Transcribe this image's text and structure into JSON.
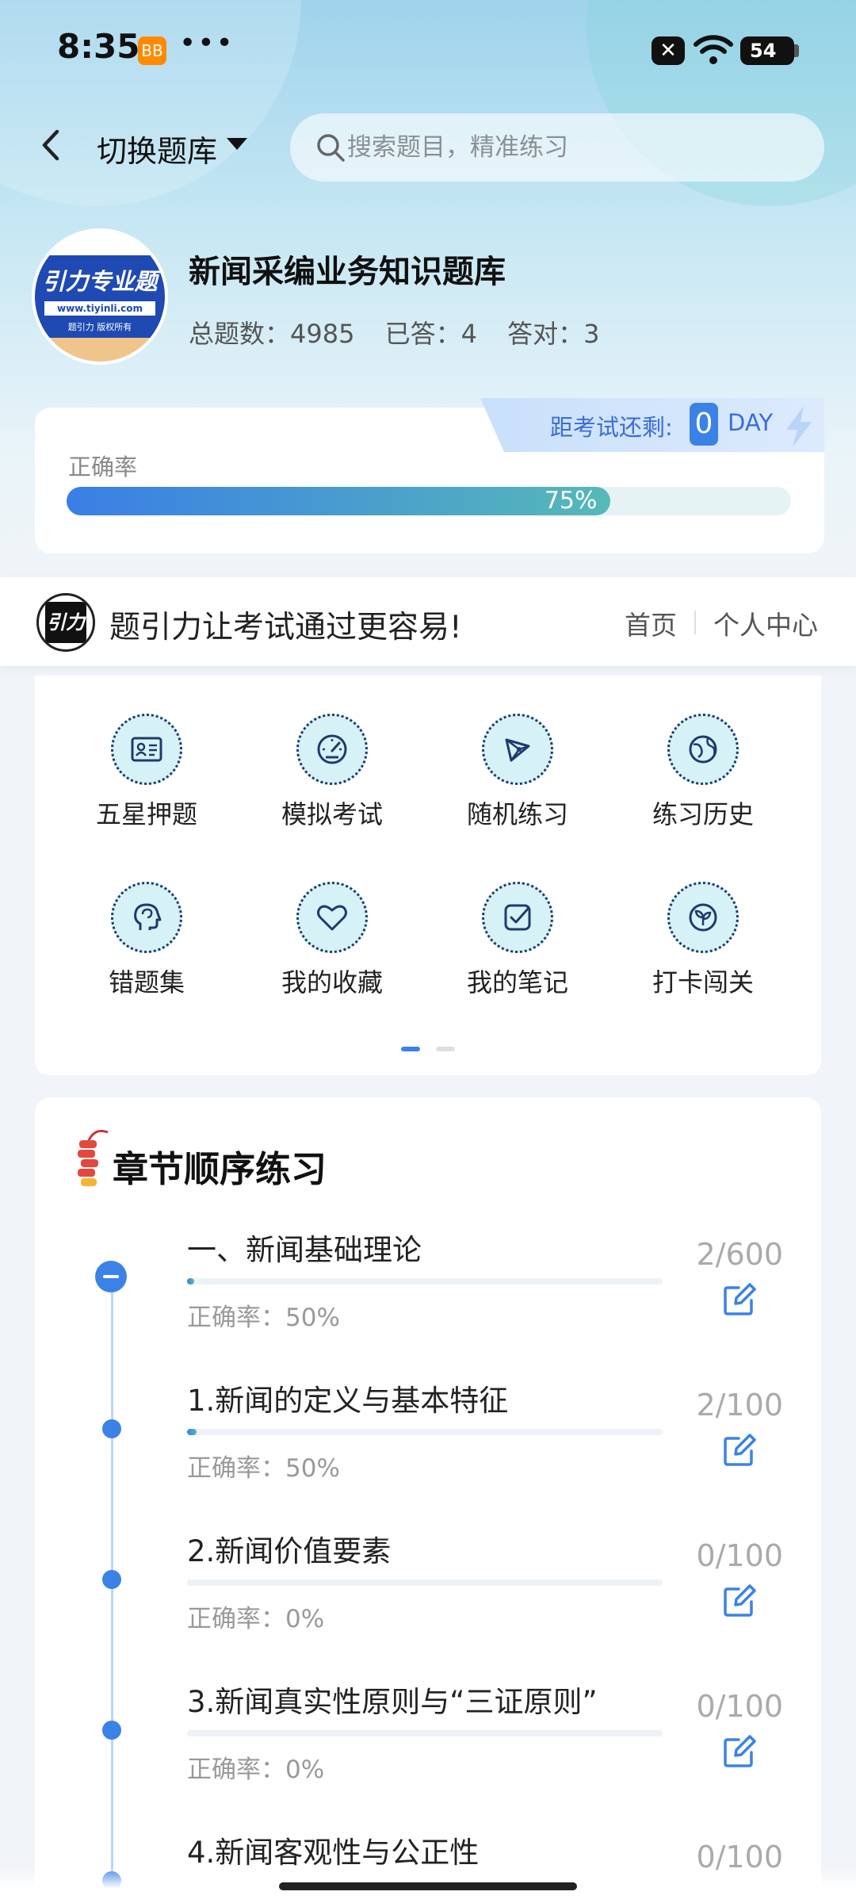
{
  "status": {
    "time": "8:35",
    "app_badge": "BB",
    "dots": "•••",
    "close_badge": "✕",
    "battery": "54"
  },
  "topbar": {
    "switch_label": "切换题库",
    "search_placeholder": "搜索题目，精准练习"
  },
  "bank": {
    "logo_line1": "引力专业题",
    "logo_url": "www.tiyinli.com",
    "logo_note": "题引力 版权所有",
    "title": "新闻采编业务知识题库",
    "total_label": "总题数：4985",
    "answered_label": "已答：4",
    "correct_label": "答对：3"
  },
  "countdown": {
    "label": "距考试还剩:",
    "value": "0",
    "unit": "DAY"
  },
  "accuracy": {
    "label": "正确率",
    "percent_text": "75%",
    "fraction": 0.75
  },
  "brandbar": {
    "icon_text": "引力",
    "slogan": "题引力让考试通过更容易!",
    "home": "首页",
    "me": "个人中心"
  },
  "functions": [
    {
      "label": "五星押题",
      "icon": "id-card-icon"
    },
    {
      "label": "模拟考试",
      "icon": "gauge-icon"
    },
    {
      "label": "随机练习",
      "icon": "network-icon"
    },
    {
      "label": "练习历史",
      "icon": "globe-icon"
    },
    {
      "label": "错题集",
      "icon": "head-icon"
    },
    {
      "label": "我的收藏",
      "icon": "heart-icon"
    },
    {
      "label": "我的笔记",
      "icon": "note-check-icon"
    },
    {
      "label": "打卡闯关",
      "icon": "sprout-icon"
    }
  ],
  "chapters_title": "章节顺序练习",
  "chapters": [
    {
      "name": "一、新闻基础理论",
      "accuracy": "正确率：50%",
      "count": "2/600",
      "progress": 0.003
    },
    {
      "name": "1.新闻的定义与基本特征",
      "accuracy": "正确率：50%",
      "count": "2/100",
      "progress": 0.02
    },
    {
      "name": "2.新闻价值要素",
      "accuracy": "正确率：0%",
      "count": "0/100",
      "progress": 0
    },
    {
      "name": "3.新闻真实性原则与“三证原则”",
      "accuracy": "正确率：0%",
      "count": "0/100",
      "progress": 0
    },
    {
      "name": "4.新闻客观性与公正性",
      "accuracy": "",
      "count": "0/100",
      "progress": 0
    }
  ],
  "colors": {
    "accent": "#3b82e6",
    "teal": "#56b9b8",
    "icon_bg": "#d7f2f6"
  }
}
